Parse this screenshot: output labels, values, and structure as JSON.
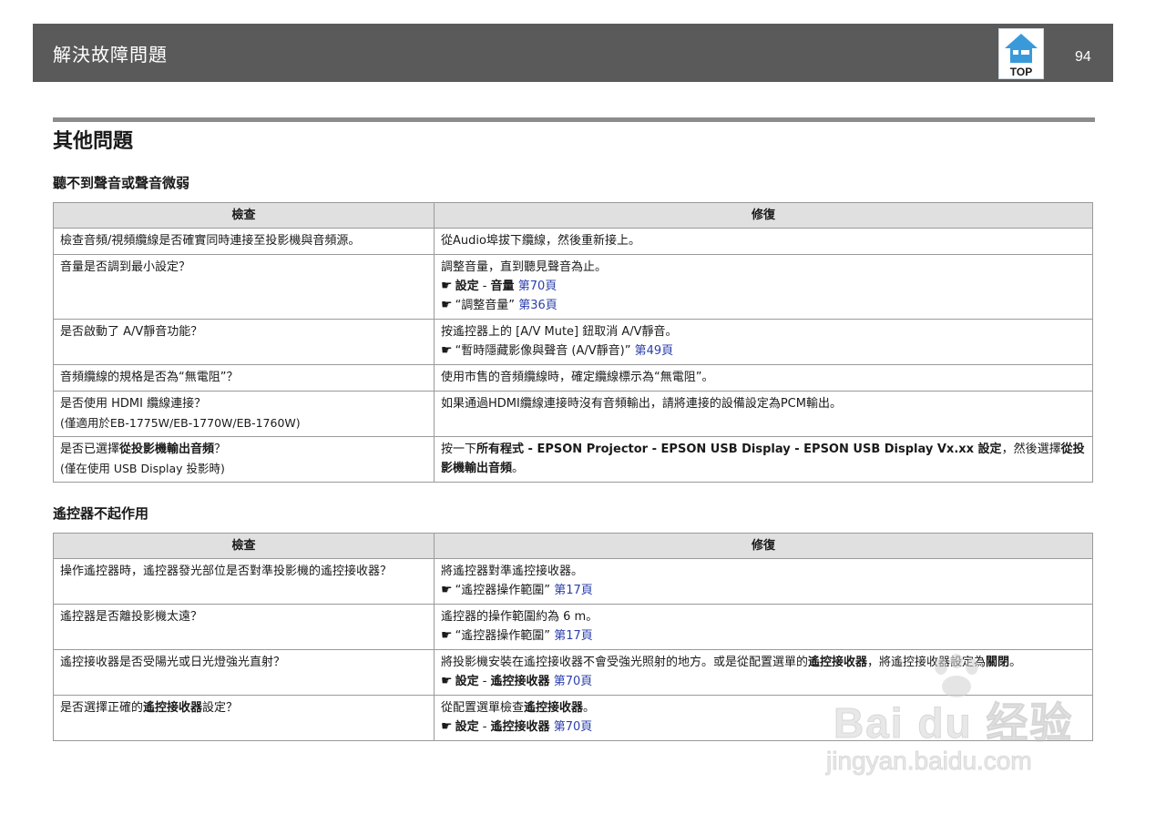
{
  "header": {
    "title": "解決故障問題",
    "top_button_label": "TOP",
    "page_number": "94"
  },
  "section": {
    "title": "其他問題"
  },
  "sound": {
    "subtitle": "聽不到聲音或聲音微弱",
    "col_check": "檢查",
    "col_fix": "修復",
    "rows": [
      {
        "check": "檢查音頻/視頻纜線是否確實同時連接至投影機與音頻源。",
        "fix": "從Audio埠拔下纜線，然後重新接上。"
      },
      {
        "check": "音量是否調到最小設定？",
        "fix": "調整音量，直到聽見聲音為止。",
        "ref1_a": "設定",
        "ref1_sep": " - ",
        "ref1_b": "音量",
        "ref1_link": "第70頁",
        "ref2_text": "“調整音量”",
        "ref2_link": "第36頁"
      },
      {
        "check": "是否啟動了 A/V靜音功能？",
        "fix": "按遙控器上的 [A/V Mute] 鈕取消 A/V靜音。",
        "ref1_text": "“暫時隱藏影像與聲音 (A/V靜音)”",
        "ref1_link": "第49頁"
      },
      {
        "check": "音頻纜線的規格是否為“無電阻”？",
        "fix": "使用市售的音頻纜線時，確定纜線標示為“無電阻”。"
      },
      {
        "check": "是否使用 HDMI 纜線連接？",
        "check_note": "(僅適用於EB-1775W/EB-1770W/EB-1760W)",
        "fix": "如果通過HDMI纜線連接時沒有音頻輸出，請將連接的設備設定為PCM輸出。"
      },
      {
        "check_a": "是否已選擇",
        "check_b": "從投影機輸出音頻",
        "check_c": "？",
        "check_note": "(僅在使用 USB Display 投影時)",
        "fix_a": "按一下",
        "fix_b": "所有程式 - EPSON Projector - EPSON USB Display - EPSON USB Display Vx.xx 設定",
        "fix_c": "，然後選擇",
        "fix_d": "從投影機輸出音頻",
        "fix_e": "。"
      }
    ]
  },
  "remote": {
    "subtitle": "遙控器不起作用",
    "col_check": "檢查",
    "col_fix": "修復",
    "rows": [
      {
        "check": "操作遙控器時，遙控器發光部位是否對準投影機的遙控接收器？",
        "fix": "將遙控器對準遙控接收器。",
        "ref1_text": "“遙控器操作範圍”",
        "ref1_link": "第17頁"
      },
      {
        "check": "遙控器是否離投影機太遠？",
        "fix": "遙控器的操作範圍約為 6 m。",
        "ref1_text": "“遙控器操作範圍”",
        "ref1_link": "第17頁"
      },
      {
        "check": "遙控接收器是否受陽光或日光燈強光直射？",
        "fix_a": "將投影機安裝在遙控接收器不會受強光照射的地方。或是從配置選單的",
        "fix_b": "遙控接收器",
        "fix_c": "，將遙控接收器設定為",
        "fix_d": "關閉",
        "fix_e": "。",
        "ref1_a": "設定",
        "ref1_sep": " - ",
        "ref1_b": "遙控接收器",
        "ref1_link": "第70頁"
      },
      {
        "check_a": "是否選擇正確的",
        "check_b": "遙控接收器",
        "check_c": "設定？",
        "fix_a": "從配置選單檢查",
        "fix_b": "遙控接收器",
        "fix_c": "。",
        "ref1_a": "設定",
        "ref1_sep": " - ",
        "ref1_b": "遙控接收器",
        "ref1_link": "第70頁"
      }
    ]
  },
  "watermark": {
    "logo": "Bai du 经验",
    "url": "jingyan.baidu.com"
  },
  "icons": {
    "reference": "pointing-hand-icon",
    "top": "projector-top-icon"
  },
  "colors": {
    "header_bg": "#5a5a5a",
    "link": "#2b3fae",
    "table_header_bg": "#e0e0e0"
  }
}
